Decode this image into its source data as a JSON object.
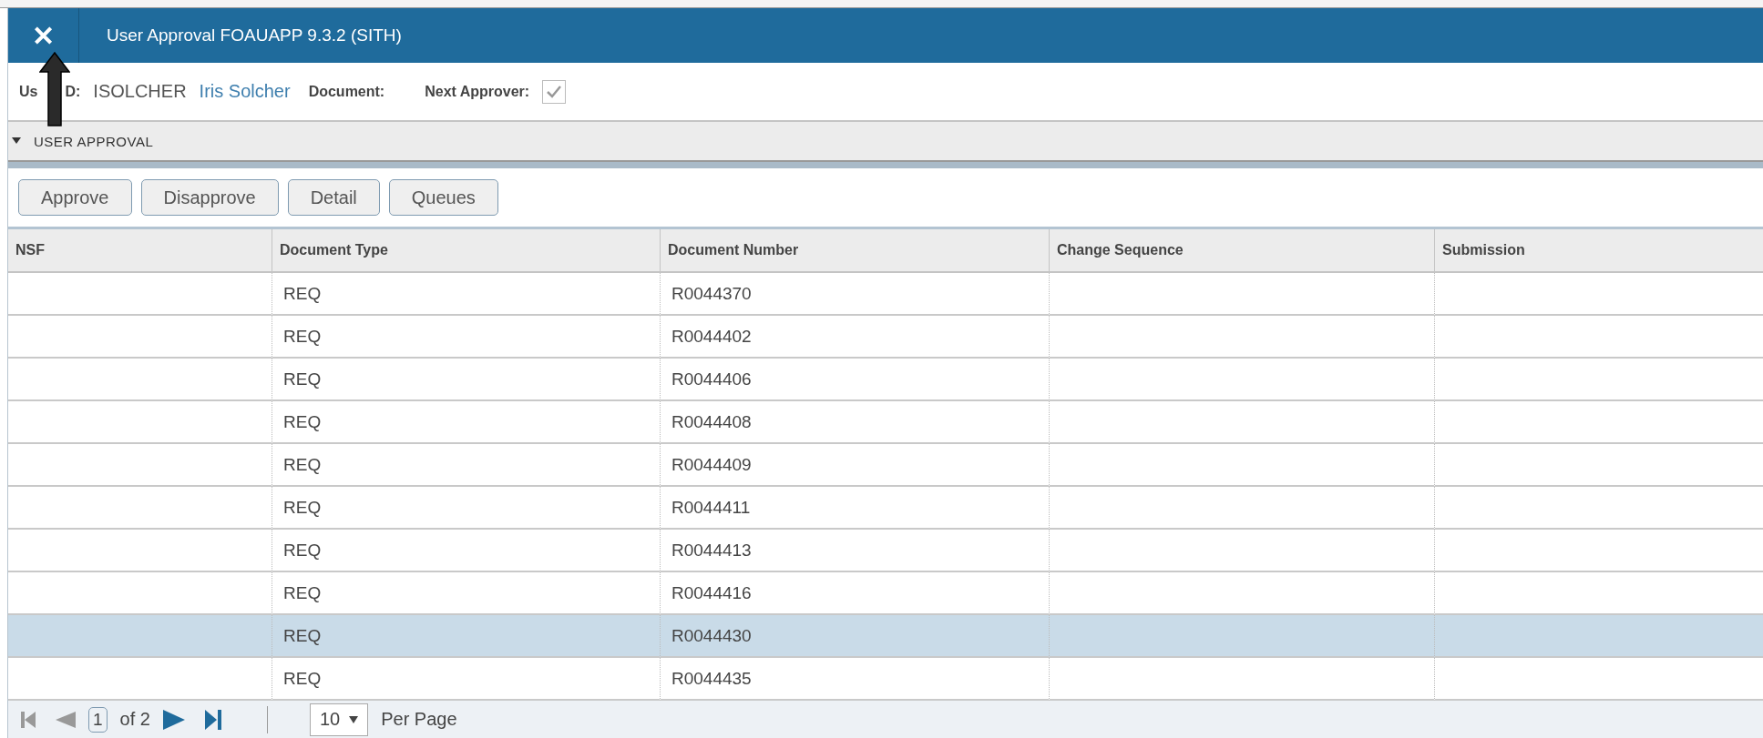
{
  "window": {
    "title": "User Approval FOAUAPP 9.3.2 (SITH)",
    "close": "✕"
  },
  "info": {
    "user_label_start": "Us",
    "user_label_end": "D:",
    "user_id": "ISOLCHER",
    "user_name": "Iris Solcher",
    "document_label": "Document:",
    "next_approver_label": "Next Approver:",
    "next_approver_checked": true
  },
  "section": {
    "title": "USER APPROVAL",
    "expanded": true
  },
  "buttons": [
    "Approve",
    "Disapprove",
    "Detail",
    "Queues"
  ],
  "table": {
    "columns": [
      "NSF",
      "Document Type",
      "Document Number",
      "Change Sequence",
      "Submission"
    ],
    "rows": [
      {
        "cells": [
          "",
          "REQ",
          "R0044370",
          "",
          ""
        ],
        "selected": false
      },
      {
        "cells": [
          "",
          "REQ",
          "R0044402",
          "",
          ""
        ],
        "selected": false
      },
      {
        "cells": [
          "",
          "REQ",
          "R0044406",
          "",
          ""
        ],
        "selected": false
      },
      {
        "cells": [
          "",
          "REQ",
          "R0044408",
          "",
          ""
        ],
        "selected": false
      },
      {
        "cells": [
          "",
          "REQ",
          "R0044409",
          "",
          ""
        ],
        "selected": false
      },
      {
        "cells": [
          "",
          "REQ",
          "R0044411",
          "",
          ""
        ],
        "selected": false
      },
      {
        "cells": [
          "",
          "REQ",
          "R0044413",
          "",
          ""
        ],
        "selected": false
      },
      {
        "cells": [
          "",
          "REQ",
          "R0044416",
          "",
          ""
        ],
        "selected": false
      },
      {
        "cells": [
          "",
          "REQ",
          "R0044430",
          "",
          ""
        ],
        "selected": true
      },
      {
        "cells": [
          "",
          "REQ",
          "R0044435",
          "",
          ""
        ],
        "selected": false
      }
    ]
  },
  "pager": {
    "page": "1",
    "of": "of 2",
    "per_page": "10",
    "per_page_label": "Per Page"
  }
}
